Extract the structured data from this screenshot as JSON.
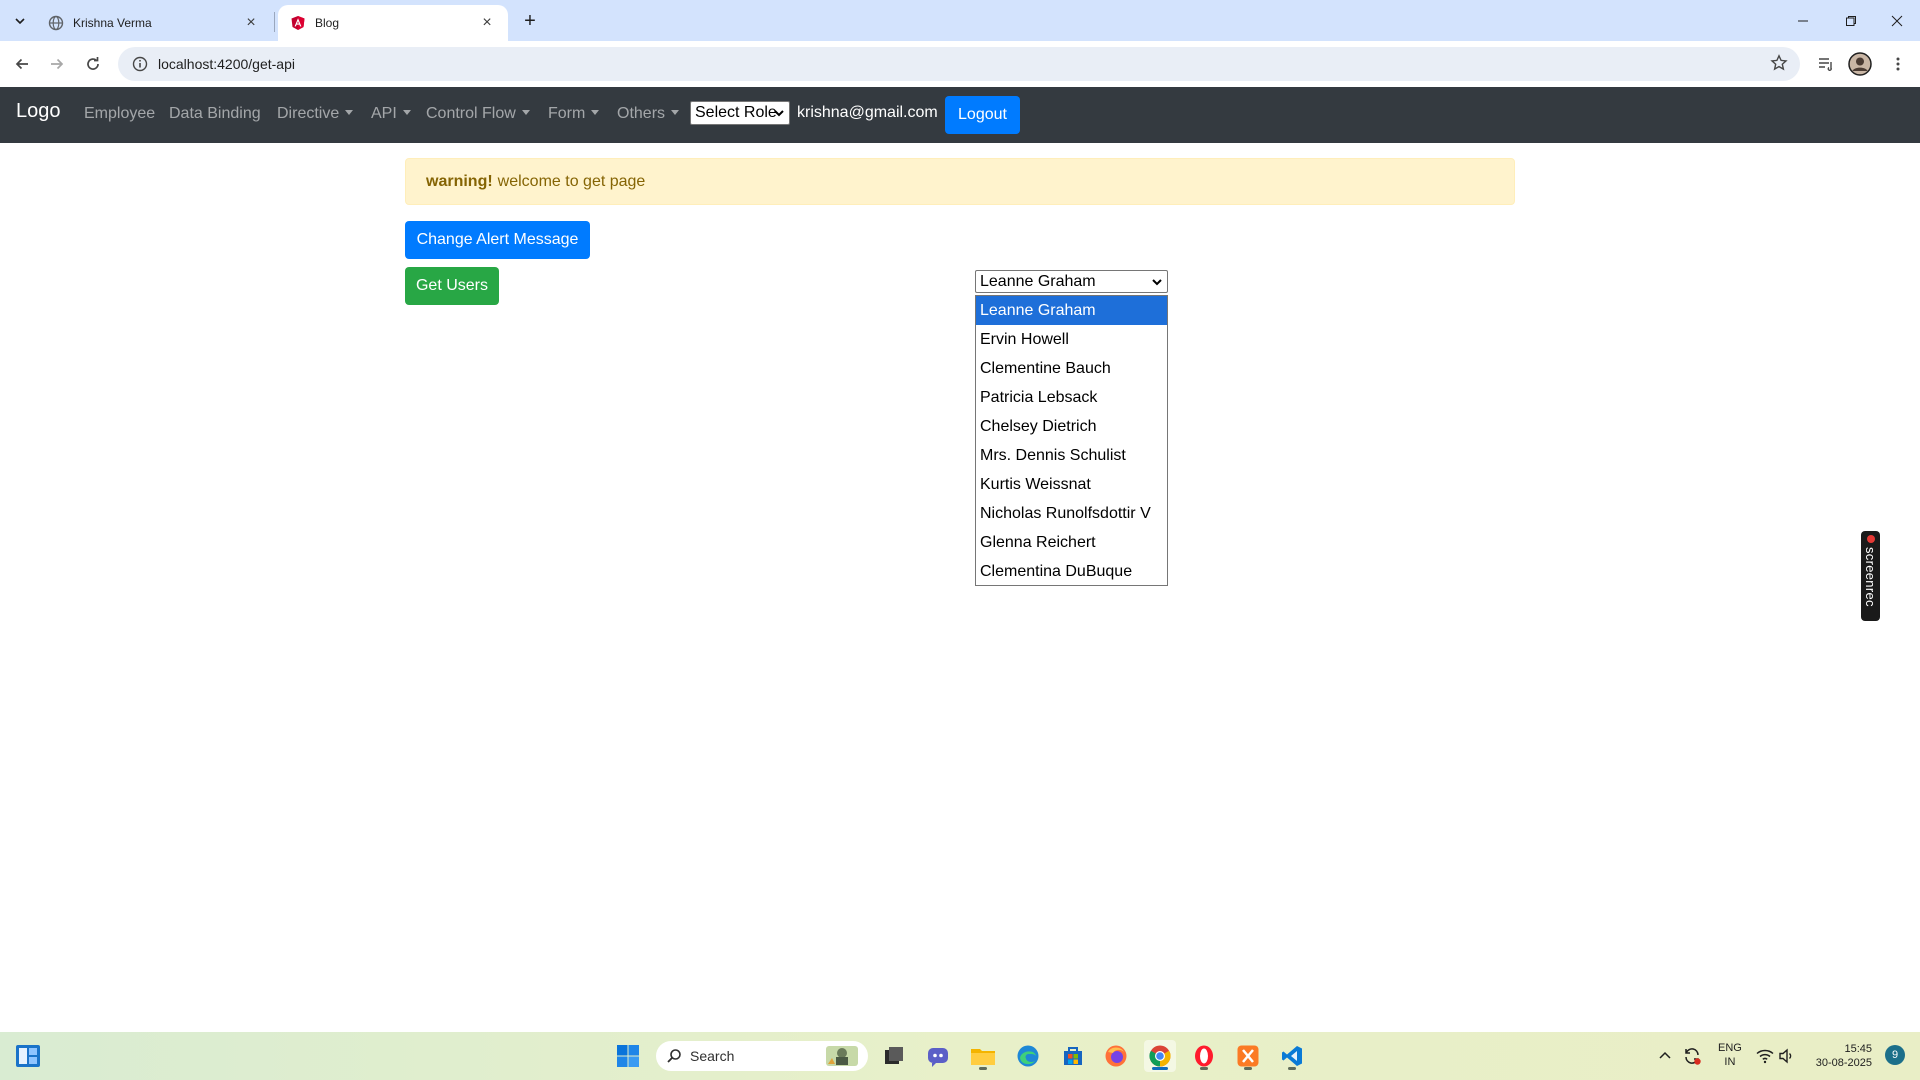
{
  "browser": {
    "tabs": [
      {
        "title": "Krishna Verma",
        "active": false
      },
      {
        "title": "Blog",
        "active": true
      }
    ],
    "url": "localhost:4200/get-api"
  },
  "navbar": {
    "brand": "Logo",
    "links": [
      {
        "label": "Employee",
        "dropdown": false
      },
      {
        "label": "Data Binding",
        "dropdown": false
      },
      {
        "label": "Directive",
        "dropdown": true
      },
      {
        "label": "API",
        "dropdown": true
      },
      {
        "label": "Control Flow",
        "dropdown": true
      },
      {
        "label": "Form",
        "dropdown": true
      },
      {
        "label": "Others",
        "dropdown": true
      }
    ],
    "role_select": "Select Role",
    "user_email": "krishna@gmail.com",
    "logout_label": "Logout"
  },
  "alert": {
    "strong": "warning!",
    "message": "welcome to get page"
  },
  "buttons": {
    "change_alert": "Change Alert Message",
    "get_users": "Get Users"
  },
  "user_select": {
    "selected": "Leanne Graham",
    "options": [
      "Leanne Graham",
      "Ervin Howell",
      "Clementine Bauch",
      "Patricia Lebsack",
      "Chelsey Dietrich",
      "Mrs. Dennis Schulist",
      "Kurtis Weissnat",
      "Nicholas Runolfsdottir V",
      "Glenna Reichert",
      "Clementina DuBuque"
    ]
  },
  "recorder_badge": "screenrec",
  "taskbar": {
    "search_placeholder": "Search",
    "lang_top": "ENG",
    "lang_bottom": "IN",
    "time": "15:45",
    "date": "30-08-2025",
    "notification_count": "9"
  },
  "colors": {
    "navbar_bg": "#343a40",
    "primary": "#007bff",
    "success": "#28a745",
    "alert_bg": "#fff3cd",
    "alert_text": "#856404",
    "dropdown_highlight": "#1e6fd9"
  }
}
